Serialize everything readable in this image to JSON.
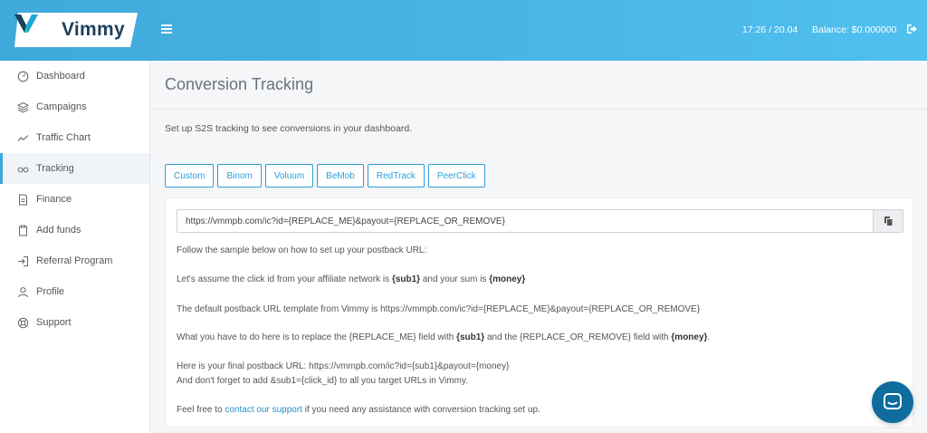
{
  "header": {
    "brand": "Vimmy",
    "time": "17:26 / 20.04",
    "balance": "Balance: $0.000000"
  },
  "sidebar": {
    "items": [
      {
        "label": "Dashboard",
        "icon": "dashboard-icon"
      },
      {
        "label": "Campaigns",
        "icon": "layers-icon"
      },
      {
        "label": "Traffic Chart",
        "icon": "line-chart-icon"
      },
      {
        "label": "Tracking",
        "icon": "glasses-icon",
        "active": true
      },
      {
        "label": "Finance",
        "icon": "document-icon"
      },
      {
        "label": "Add funds",
        "icon": "clipboard-icon"
      },
      {
        "label": "Referral Program",
        "icon": "sign-in-icon"
      },
      {
        "label": "Profile",
        "icon": "user-icon"
      },
      {
        "label": "Support",
        "icon": "lifebuoy-icon"
      }
    ]
  },
  "main": {
    "title": "Conversion Tracking",
    "subtitle": "Set up S2S tracking to see conversions in your dashboard.",
    "tabs": [
      "Custom",
      "Binom",
      "Voluum",
      "BeMob",
      "RedTrack",
      "PeerClick"
    ],
    "postback_url": "https://vmmpb.com/ic?id={REPLACE_ME}&payout={REPLACE_OR_REMOVE}",
    "instructions": {
      "intro": "Follow the sample below on how to set up your postback URL:",
      "assume_pre": "Let's assume the click id from your affiliate network is ",
      "assume_b1": "{sub1}",
      "assume_mid": " and your sum is ",
      "assume_b2": "{money}",
      "default_template": "The default postback URL template from Vimmy is https://vmmpb.com/ic?id={REPLACE_ME}&payout={REPLACE_OR_REMOVE}",
      "replace_pre": "What you have to do here is to replace the {REPLACE_ME} field with ",
      "replace_b1": "{sub1}",
      "replace_mid": " and the {REPLACE_OR_REMOVE} field with ",
      "replace_b2": "{money}",
      "replace_end": ".",
      "final_url": "Here is your final postback URL: https://vmmpb.com/ic?id={sub1}&payout={money}",
      "add_sub": "And don't forget to add &sub1={click_id} to all you target URLs in Vimmy.",
      "support_pre": "Feel free to ",
      "support_link": "contact our support",
      "support_post": " if you need any assistance with conversion tracking set up."
    }
  },
  "colors": {
    "header": "#48b6e6",
    "accent": "#2d9fd6",
    "chat": "#0e6c9e"
  }
}
